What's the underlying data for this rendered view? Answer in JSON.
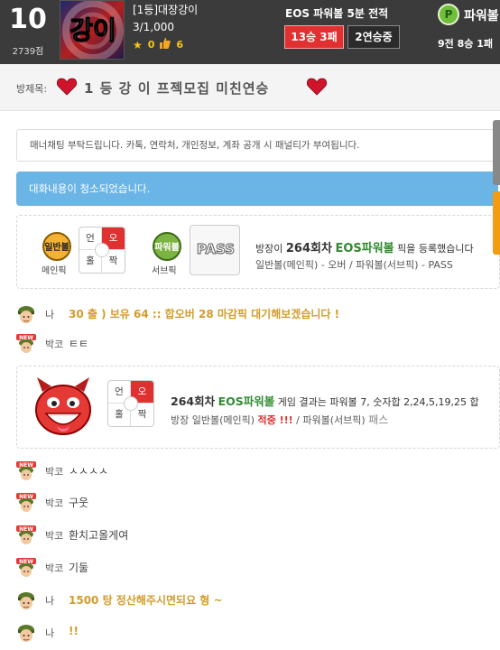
{
  "header": {
    "level": "10",
    "points": "2739점",
    "logo_text": "강이",
    "room_title": "[1등]대장강이",
    "room_count": "3/1,000",
    "stars": "0",
    "likes": "6",
    "eos_title": "EOS 파워볼 5분 전적",
    "win_badge": "13승 3패",
    "streak_badge": "2연승중",
    "pb_icon_letter": "P",
    "pb_title": "파워볼",
    "pb_record": "9전 8승 1패"
  },
  "room_bar": {
    "label": "방제목:",
    "name": "1 등 강 이 프젝모집 미친연승"
  },
  "notice": "매너채팅 부탁드립니다. 카톡, 연락처, 개인정보, 계좌 공개 시 패널티가 부여됩니다.",
  "cleared": "대화내용이 청소되었습니다.",
  "pick": {
    "general_badge": "일반볼",
    "general_caption": "메인픽",
    "powerball_badge": "파워볼",
    "powerball_caption": "서브픽",
    "grid": {
      "tl": "언",
      "tr": "오",
      "bl": "홀",
      "br": "짝"
    },
    "pass_label": "PASS",
    "line1_prefix": "방장이",
    "line1_round": "264회차",
    "line1_game": "EOS파워볼",
    "line1_suffix": "픽을 등록했습니다",
    "line2": "일반볼(메인픽) - 오버 / 파워볼(서브픽) - PASS"
  },
  "chat": [
    {
      "name": "나",
      "avatar": "soldier-avatar-icon",
      "message": "30 출 ) 보유 64 :: 합오버 28 마감픽 대기해보겠습니다 !",
      "highlight": true
    },
    {
      "name": "박코",
      "avatar": "new-user-avatar-icon",
      "message": "ㅌㅌ",
      "highlight": false
    }
  ],
  "result": {
    "line1_round": "264회차",
    "line1_game": "EOS파워볼",
    "line1_text": "게임 결과는 파워볼 7, 숫자합 2,24,5,19,25 합",
    "line2_prefix": "방장 일반볼(메인픽)",
    "line2_hit": "적중 !!!",
    "line2_mid": "/ 파워볼(서브픽)",
    "line2_pass": "패스",
    "grid": {
      "tl": "언",
      "tr": "오",
      "bl": "홀",
      "br": "짝"
    }
  },
  "chat2": [
    {
      "name": "박코",
      "avatar": "new-user-avatar-icon",
      "message": "ㅅㅅㅅㅅ",
      "highlight": false
    },
    {
      "name": "박코",
      "avatar": "new-user-avatar-icon",
      "message": "구웃",
      "highlight": false
    },
    {
      "name": "박코",
      "avatar": "new-user-avatar-icon",
      "message": "환치고올게여",
      "highlight": false
    },
    {
      "name": "박코",
      "avatar": "new-user-avatar-icon",
      "message": "기둘",
      "highlight": false
    },
    {
      "name": "나",
      "avatar": "soldier-avatar-icon",
      "message": "1500 탕 정산해주시면되요 형 ~",
      "highlight": true
    },
    {
      "name": "나",
      "avatar": "soldier-avatar-icon",
      "message": "!!",
      "highlight": true
    }
  ],
  "colors": {
    "header_bg": "#3b3b3b",
    "win_red": "#e03030",
    "cleared_blue": "#6ab4e6",
    "chat_gold": "#d39c2a",
    "powerball_green": "#2e8b2e"
  }
}
